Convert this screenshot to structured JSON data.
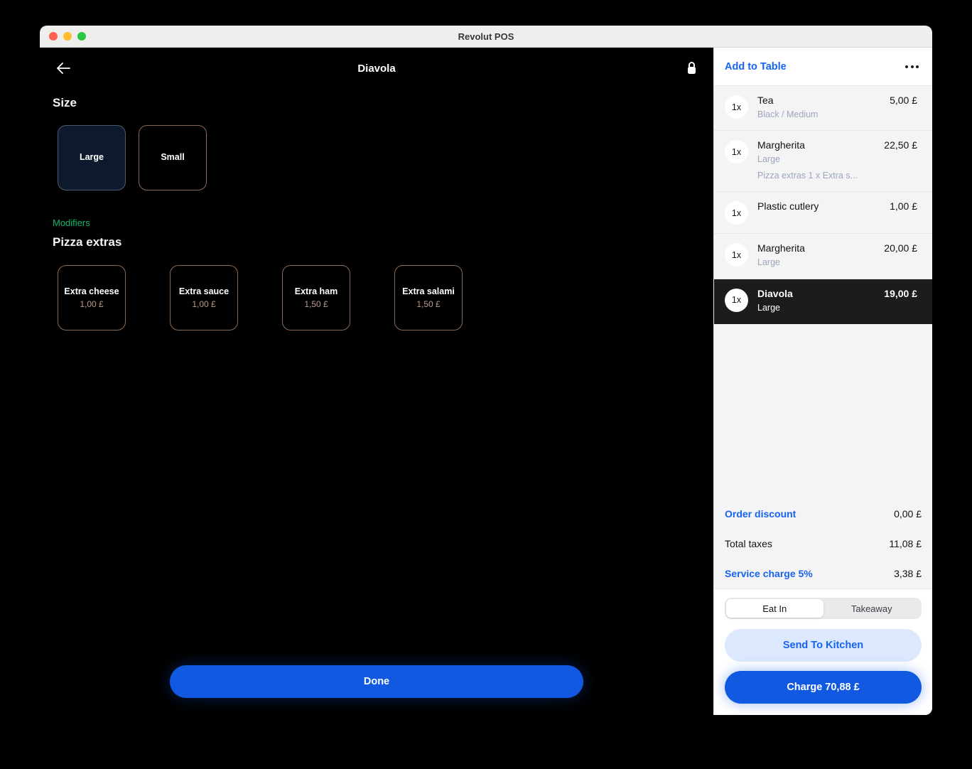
{
  "window": {
    "title": "Revolut POS"
  },
  "product": {
    "title": "Diavola",
    "back_icon": "arrow-left-icon",
    "lock_icon": "lock-icon",
    "size_section_label": "Size",
    "size_options": [
      {
        "name": "Large",
        "selected": true
      },
      {
        "name": "Small",
        "selected": false
      }
    ],
    "modifiers_tag": "Modifiers",
    "modifiers_title": "Pizza extras",
    "modifier_options": [
      {
        "name": "Extra cheese",
        "price": "1,00 £"
      },
      {
        "name": "Extra sauce",
        "price": "1,00 £"
      },
      {
        "name": "Extra ham",
        "price": "1,50 £"
      },
      {
        "name": "Extra salami",
        "price": "1,50 £"
      }
    ],
    "done_label": "Done"
  },
  "order": {
    "add_to_table_label": "Add to Table",
    "more_icon": "more-horizontal-icon",
    "items": [
      {
        "qty": "1x",
        "name": "Tea",
        "sub1": "Black / Medium",
        "sub2": "",
        "price": "5,00 £",
        "active": false
      },
      {
        "qty": "1x",
        "name": "Margherita",
        "sub1": "Large",
        "sub2": "Pizza extras 1 x Extra s...",
        "price": "22,50 £",
        "active": false
      },
      {
        "qty": "1x",
        "name": "Plastic cutlery",
        "sub1": "",
        "sub2": "",
        "price": "1,00 £",
        "active": false
      },
      {
        "qty": "1x",
        "name": "Margherita",
        "sub1": "Large",
        "sub2": "",
        "price": "20,00 £",
        "active": false
      },
      {
        "qty": "1x",
        "name": "Diavola",
        "sub1": "Large",
        "sub2": "",
        "price": "19,00 £",
        "active": true
      }
    ],
    "totals": [
      {
        "label": "Order discount",
        "value": "0,00 £",
        "is_link": true
      },
      {
        "label": "Total taxes",
        "value": "11,08 £",
        "is_link": false
      },
      {
        "label": "Service charge 5%",
        "value": "3,38 £",
        "is_link": true
      }
    ],
    "service_mode": {
      "options": [
        "Eat In",
        "Takeaway"
      ],
      "selected": "Eat In"
    },
    "send_to_kitchen_label": "Send To Kitchen",
    "charge_label": "Charge 70,88 £"
  },
  "colors": {
    "accent_blue": "#1763f0",
    "primary_button": "#1059e0",
    "modifiers_green": "#12b76a",
    "option_border": "#8a6a55",
    "selected_option_bg": "#0d1a2e"
  }
}
